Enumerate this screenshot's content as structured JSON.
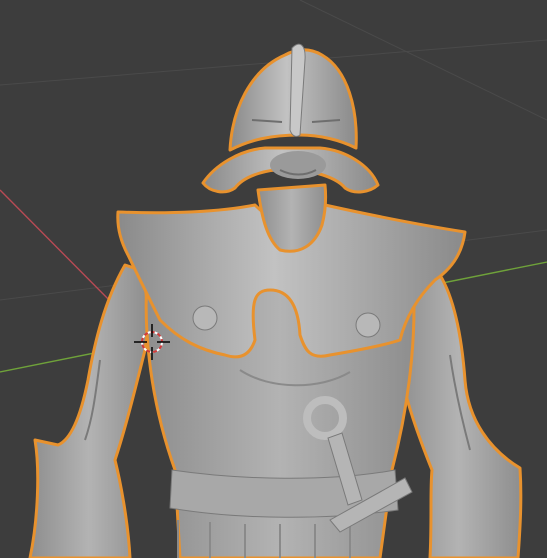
{
  "viewport": {
    "background": "#3d3d3d",
    "grid_color": "#4a4a4a",
    "x_axis_color": "#b84a54",
    "y_axis_color": "#6fa23a",
    "selection_outline_color": "#e8922e",
    "model_fill": "#a3a3a3",
    "model_shadow": "#7a7a7a",
    "model_highlight": "#bdbdbd"
  },
  "scene": {
    "selected_object": "armored-figure-sculpt",
    "cursor_icon": "3d-cursor-icon"
  }
}
